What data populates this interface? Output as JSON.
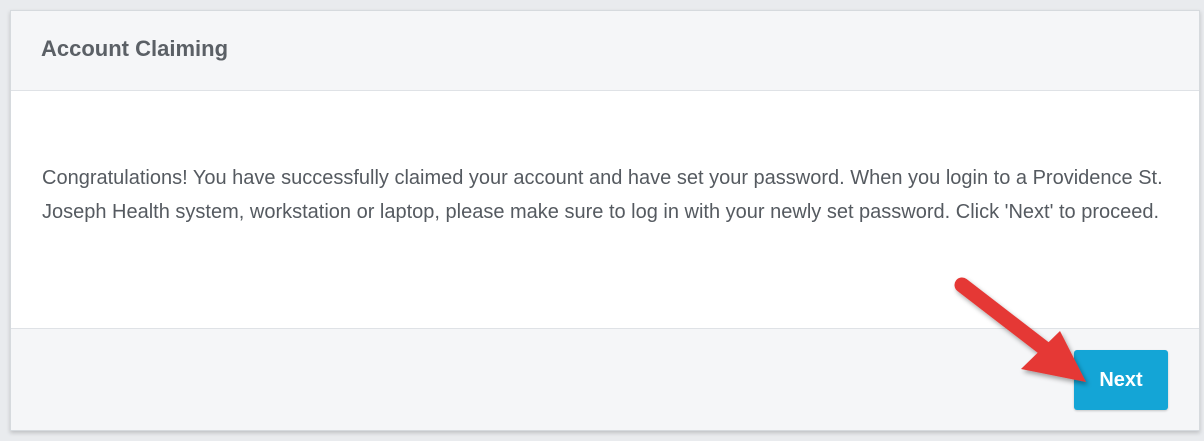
{
  "panel": {
    "title": "Account Claiming",
    "message": "Congratulations! You have successfully claimed your account and have set your password. When you login to a Providence St. Joseph Health system, workstation or laptop, please make sure to log in with your newly set password. Click 'Next' to proceed.",
    "next_label": "Next"
  },
  "colors": {
    "accent": "#14a5d6",
    "annotation_arrow": "#e53935"
  },
  "icons": {
    "annotation": "red-arrow-icon"
  }
}
